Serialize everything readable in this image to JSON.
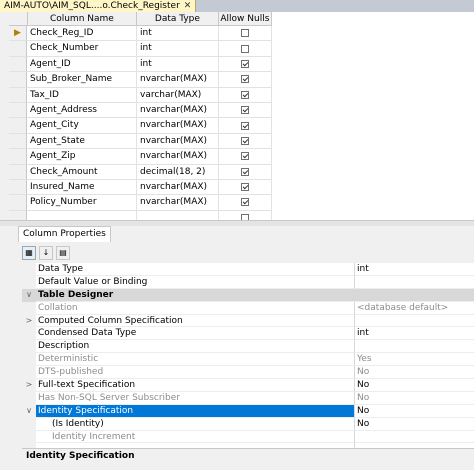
{
  "tab": {
    "title": "AIM-AUTO\\AIM_SQL....o.Check_Register",
    "close": "✕"
  },
  "grid": {
    "headers": {
      "name": "Column Name",
      "type": "Data Type",
      "nulls": "Allow Nulls"
    },
    "rows": [
      {
        "name": "Check_Reg_ID",
        "type": "int",
        "nulls": false,
        "key": true
      },
      {
        "name": "Check_Number",
        "type": "int",
        "nulls": false
      },
      {
        "name": "Agent_ID",
        "type": "int",
        "nulls": true
      },
      {
        "name": "Sub_Broker_Name",
        "type": "nvarchar(MAX)",
        "nulls": true
      },
      {
        "name": "Tax_ID",
        "type": "varchar(MAX)",
        "nulls": true
      },
      {
        "name": "Agent_Address",
        "type": "nvarchar(MAX)",
        "nulls": true
      },
      {
        "name": "Agent_City",
        "type": "nvarchar(MAX)",
        "nulls": true
      },
      {
        "name": "Agent_State",
        "type": "nvarchar(MAX)",
        "nulls": true
      },
      {
        "name": "Agent_Zip",
        "type": "nvarchar(MAX)",
        "nulls": true
      },
      {
        "name": "Check_Amount",
        "type": "decimal(18, 2)",
        "nulls": true
      },
      {
        "name": "Insured_Name",
        "type": "nvarchar(MAX)",
        "nulls": true
      },
      {
        "name": "Policy_Number",
        "type": "nvarchar(MAX)",
        "nulls": true
      },
      {
        "name": "",
        "type": "",
        "nulls": false
      }
    ]
  },
  "properties": {
    "tab_label": "Column Properties",
    "rows": [
      {
        "gutter": "",
        "name": "Data Type",
        "value": "int",
        "style": ""
      },
      {
        "gutter": "",
        "name": "Default Value or Binding",
        "value": "",
        "style": ""
      },
      {
        "gutter": "∨",
        "name": "Table Designer",
        "value": "",
        "style": "cat"
      },
      {
        "gutter": "",
        "name": "Collation",
        "value": "<database default>",
        "style": "dim"
      },
      {
        "gutter": ">",
        "name": "Computed Column Specification",
        "value": "",
        "style": ""
      },
      {
        "gutter": "",
        "name": "Condensed Data Type",
        "value": "int",
        "style": ""
      },
      {
        "gutter": "",
        "name": "Description",
        "value": "",
        "style": ""
      },
      {
        "gutter": "",
        "name": "Deterministic",
        "value": "Yes",
        "style": "dim"
      },
      {
        "gutter": "",
        "name": "DTS-published",
        "value": "No",
        "style": "dim"
      },
      {
        "gutter": ">",
        "name": "Full-text Specification",
        "value": "No",
        "style": ""
      },
      {
        "gutter": "",
        "name": "Has Non-SQL Server Subscriber",
        "value": "No",
        "style": "dim"
      },
      {
        "gutter": "∨",
        "name": "Identity Specification",
        "value": "No",
        "style": "hl"
      },
      {
        "gutter": "",
        "name": "(Is Identity)",
        "value": "No",
        "style": "indent"
      },
      {
        "gutter": "",
        "name": "Identity Increment",
        "value": "",
        "style": "indent dim"
      },
      {
        "gutter": "",
        "name": "",
        "value": "",
        "style": ""
      }
    ],
    "description_title": "Identity Specification"
  }
}
